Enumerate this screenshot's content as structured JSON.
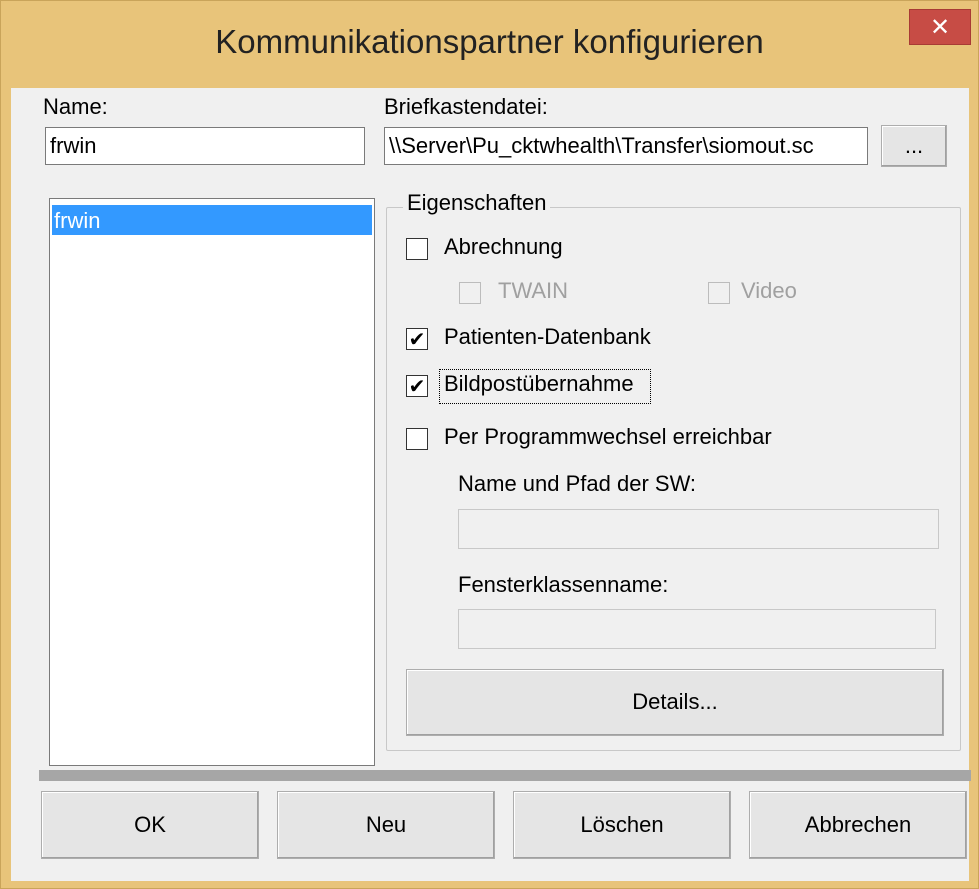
{
  "window": {
    "title": "Kommunikationspartner konfigurieren",
    "close_glyph": "✕"
  },
  "name_label": "Name:",
  "name_value": "frwin",
  "mailbox_label": "Briefkastendatei:",
  "mailbox_value": "\\\\Server\\Pu_cktwhealth\\Transfer\\siomout.sc",
  "browse_label": "...",
  "list": {
    "items": [
      "frwin"
    ]
  },
  "properties": {
    "legend": "Eigenschaften",
    "abrechnung": {
      "label": "Abrechnung",
      "checked": false
    },
    "twain": {
      "label": "TWAIN",
      "checked": false
    },
    "video": {
      "label": "Video",
      "checked": false
    },
    "patienten": {
      "label": "Patienten-Datenbank",
      "checked": true
    },
    "bildpost": {
      "label": "Bildpostübernahme",
      "checked": true
    },
    "programmwechsel": {
      "label": "Per Programmwechsel erreichbar",
      "checked": false
    },
    "sw_path_label": "Name und Pfad der SW:",
    "sw_path_value": "",
    "window_class_label": "Fensterklassenname:",
    "window_class_value": "",
    "details_button": "Details..."
  },
  "buttons": {
    "ok": "OK",
    "new": "Neu",
    "delete": "Löschen",
    "cancel": "Abbrechen"
  },
  "check_glyph": "✔"
}
